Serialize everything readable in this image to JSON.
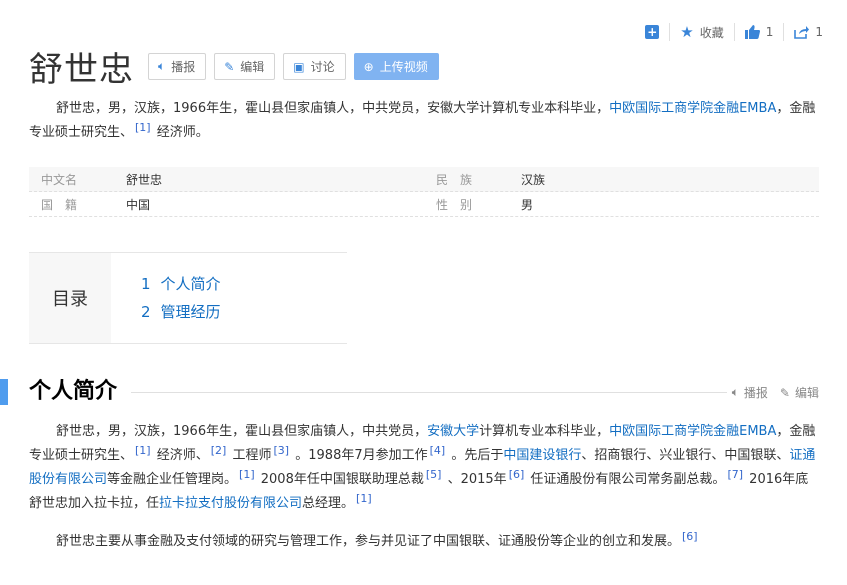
{
  "toolbar": {
    "collect_label": "收藏",
    "like_count": "1",
    "share_count": "1"
  },
  "header": {
    "title": "舒世忠",
    "buttons": {
      "play": "播报",
      "edit": "编辑",
      "discuss": "讨论",
      "upload": "上传视频"
    }
  },
  "summary": {
    "text1": "舒世忠，男，汉族，1966年生，霍山县但家庙镇人，中共党员，安徽大学计算机专业本科毕业，",
    "link1": "中欧国际工商学院金融EMBA",
    "text2": "，金融专业硕士研究生、",
    "ref1": "[1]",
    "text3": "经济师。"
  },
  "basic_info": [
    {
      "name": "中文名",
      "value": "舒世忠",
      "name2": "民　族",
      "value2": "汉族"
    },
    {
      "name": "国　籍",
      "value": "中国",
      "name2": "性　别",
      "value2": "男"
    }
  ],
  "catalog": {
    "label": "目录",
    "items": [
      {
        "num": "1",
        "text": "个人简介"
      },
      {
        "num": "2",
        "text": "管理经历"
      }
    ]
  },
  "section": {
    "title": "个人简介",
    "play_label": "播报",
    "edit_label": "编辑"
  },
  "para1": {
    "t1": "舒世忠，男，汉族，1966年生，霍山县但家庙镇人，中共党员，",
    "l1": "安徽大学",
    "t2": "计算机专业本科毕业，",
    "l2": "中欧国际工商学院金融EMBA",
    "t3": "，金融专业硕士研究生、",
    "r1": "[1]",
    "t4": "经济师、",
    "r2": "[2]",
    "t5": "工程师",
    "r3": "[3]",
    "t6": "。1988年7月参加工作",
    "r4": "[4]",
    "t7": "。先后于",
    "l3": "中国建设银行",
    "t8": "、招商银行、兴业银行、中国银联、",
    "l4": "证通股份有限公司",
    "t9": "等金融企业任管理岗。",
    "r5": "[1]",
    "t10": "2008年任中国银联助理总裁",
    "r6": "[5]",
    "t11": "、2015年",
    "r7": "[6]",
    "t12": "任证通股份有限公司常务副总裁。",
    "r8": "[7]",
    "t13": "2016年底舒世忠加入拉卡拉，任",
    "l5": "拉卡拉支付股份有限公司",
    "t14": "总经理。",
    "r9": "[1]"
  },
  "para2": {
    "t1": "舒世忠主要从事金融及支付领域的研究与管理工作，参与并见证了中国银联、证通股份等企业的创立和发展。",
    "r1": "[6]"
  }
}
